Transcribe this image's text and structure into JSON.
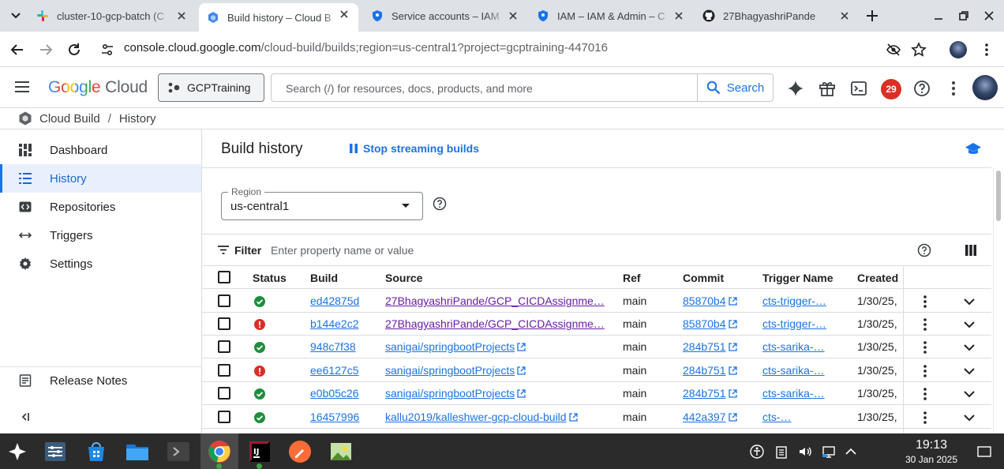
{
  "browser": {
    "tabs": [
      {
        "title": "cluster-10-gcp-batch (C",
        "icon": "slack-icon",
        "active": false
      },
      {
        "title": "Build history – Cloud B",
        "icon": "cloud-build-icon",
        "active": true
      },
      {
        "title": "Service accounts – IAM",
        "icon": "iam-shield-icon",
        "active": false
      },
      {
        "title": "IAM – IAM & Admin – C",
        "icon": "iam-shield-icon",
        "active": false
      },
      {
        "title": "27BhagyashriPande",
        "icon": "github-icon",
        "active": false
      }
    ],
    "url_host": "console.cloud.google.com",
    "url_path": "/cloud-build/builds;region=us-central1?project=gcptraining-447016"
  },
  "header": {
    "logo_google": "Google",
    "logo_cloud": "Cloud",
    "project": "GCPTraining",
    "search_placeholder": "Search (/) for resources, docs, products, and more",
    "search_button": "Search",
    "notification_count": "29"
  },
  "breadcrumb": {
    "product": "Cloud Build",
    "separator": "/",
    "page": "History"
  },
  "sidebar": {
    "items": [
      {
        "label": "Dashboard",
        "icon": "dashboard-icon"
      },
      {
        "label": "History",
        "icon": "list-icon"
      },
      {
        "label": "Repositories",
        "icon": "code-icon"
      },
      {
        "label": "Triggers",
        "icon": "triggers-icon"
      },
      {
        "label": "Settings",
        "icon": "gear-icon"
      }
    ],
    "release_notes": "Release Notes"
  },
  "main": {
    "title": "Build history",
    "stop_streaming": "Stop streaming builds",
    "region_label": "Region",
    "region_value": "us-central1",
    "filter_label": "Filter",
    "filter_placeholder": "Enter property name or value"
  },
  "table": {
    "columns": [
      "Status",
      "Build",
      "Source",
      "Ref",
      "Commit",
      "Trigger Name",
      "Created"
    ],
    "rows": [
      {
        "status": "success",
        "build": "ed42875d",
        "source": "27BhagyashriPande/GCP_CICDAssignme…",
        "source_ext": false,
        "ref": "main",
        "commit": "85870b4",
        "trigger": "cts-trigger-…",
        "created": "1/30/25,"
      },
      {
        "status": "error",
        "build": "b144e2c2",
        "source": "27BhagyashriPande/GCP_CICDAssignme…",
        "source_ext": false,
        "ref": "main",
        "commit": "85870b4",
        "trigger": "cts-trigger-…",
        "created": "1/30/25,"
      },
      {
        "status": "success",
        "build": "948c7f38",
        "source": "sanigai/springbootProjects",
        "source_ext": true,
        "ref": "main",
        "commit": "284b751",
        "trigger": "cts-sarika-…",
        "created": "1/30/25,"
      },
      {
        "status": "error",
        "build": "ee6127c5",
        "source": "sanigai/springbootProjects",
        "source_ext": true,
        "ref": "main",
        "commit": "284b751",
        "trigger": "cts-sarika-…",
        "created": "1/30/25,"
      },
      {
        "status": "success",
        "build": "e0b05c26",
        "source": "sanigai/springbootProjects",
        "source_ext": true,
        "ref": "main",
        "commit": "284b751",
        "trigger": "cts-sarika-…",
        "created": "1/30/25,"
      },
      {
        "status": "success",
        "build": "16457996",
        "source": "kallu2019/kalleshwer-gcp-cloud-build",
        "source_ext": true,
        "ref": "main",
        "commit": "442a397",
        "trigger": "cts-…",
        "created": "1/30/25,"
      }
    ]
  },
  "taskbar": {
    "time": "19:13",
    "date": "30 Jan 2025"
  },
  "colors": {
    "accent": "#1a73e8",
    "success": "#1e8e3e",
    "error": "#d93025",
    "visited_link": "#681da8",
    "taskbar": "#2b2b2b"
  }
}
